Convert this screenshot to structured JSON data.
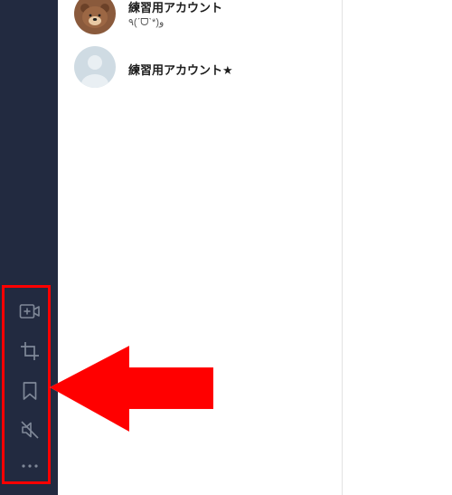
{
  "chats": [
    {
      "name": "練習用アカウント",
      "status": "٩(ˊᗜˋ*)و",
      "avatar": "brown-bear-icon"
    },
    {
      "name": "練習用アカウント★",
      "status": "",
      "avatar": "default-user-icon"
    }
  ],
  "toolbar": [
    {
      "icon": "video-call-icon",
      "label": "video call"
    },
    {
      "icon": "crop-icon",
      "label": "screenshot"
    },
    {
      "icon": "bookmark-icon",
      "label": "keep"
    },
    {
      "icon": "mute-icon",
      "label": "mute"
    },
    {
      "icon": "more-icon",
      "label": "more"
    }
  ],
  "colors": {
    "sidebar": "#222a40",
    "highlight": "#ff0000",
    "icon": "#7f8898"
  }
}
